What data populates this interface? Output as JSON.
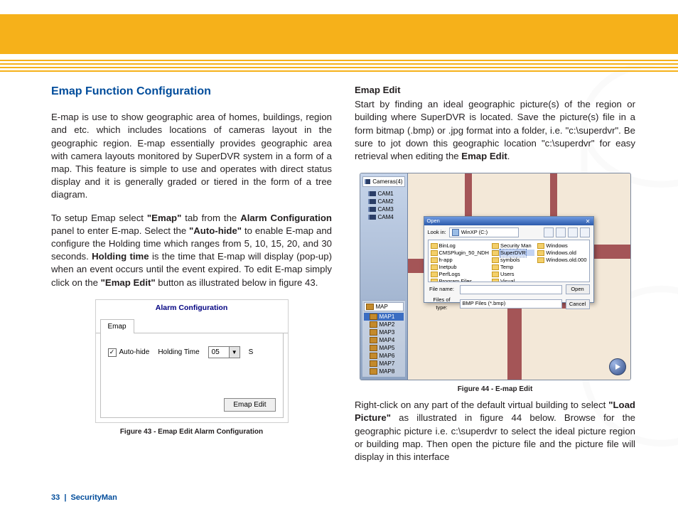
{
  "page": {
    "number": "33",
    "brand": "SecurityMan"
  },
  "left": {
    "title": "Emap Function Configuration",
    "p1": "E-map is use to show geographic area of homes, buildings, region and etc. which includes locations of cameras layout in the geographic region.   E-map essentially provides geographic area with camera layouts monitored by SuperDVR system in a form of a map.  This feature is simple to use and operates with direct status display and it is generally graded or tiered in the form of a tree diagram.",
    "p2_a": "To setup Emap select ",
    "p2_b": "\"Emap\"",
    "p2_c": " tab from the ",
    "p2_d": "Alarm Configuration",
    "p2_e": " panel to enter E-map.  Select the ",
    "p2_f": "\"Auto-hide\"",
    "p2_g": " to enable E-map and configure the Holding time which ranges from 5, 10, 15, 20, and 30 seconds.  ",
    "p2_h": "Holding time",
    "p2_i": " is the time that E-map will display (pop-up) when an event occurs until the event expired.  To edit E-map simply click on the ",
    "p2_j": "\"Emap Edit\"",
    "p2_k": " button as illustrated below in figure 43."
  },
  "fig43": {
    "windowTitle": "Alarm Configuration",
    "tab": "Emap",
    "autoHide": "Auto-hide",
    "holdingTime": "Holding Time",
    "holdValue": "05",
    "unit": "S",
    "editBtn": "Emap Edit",
    "caption": "Figure 43 - Emap Edit Alarm Configuration"
  },
  "right": {
    "subhead": "Emap Edit",
    "p1_a": "Start by finding an ideal geographic picture(s) of the region or building where SuperDVR is located.  Save the picture(s) file in a form bitmap (.bmp) or .jpg format into a folder, i.e. \"c:\\superdvr\".  Be sure to jot down this geographic location \"c:\\superdvr\" for easy retrieval when editing the ",
    "p1_b": "Emap Edit",
    "p1_c": ".",
    "p2_a": "Right-click on any part of the default virtual building to select ",
    "p2_b": "\"Load Picture\"",
    "p2_c": " as illustrated in figure 44 below.  Browse for the geographic picture i.e. c:\\superdvr to select the ideal picture region or building map.  Then open the picture file and the picture file will display in this interface"
  },
  "fig44": {
    "caption": "Figure 44 -  E-map Edit",
    "sidebar": {
      "root": "Cameras(4)",
      "cams": [
        "CAM1",
        "CAM2",
        "CAM3",
        "CAM4"
      ],
      "mapGroup": "MAP",
      "maps": [
        "MAP1",
        "MAP2",
        "MAP3",
        "MAP4",
        "MAP5",
        "MAP6",
        "MAP7",
        "MAP8"
      ]
    },
    "dialog": {
      "title": "Open",
      "lookInLabel": "Look in:",
      "lookInValue": "WinXP (C:)",
      "files": [
        "BinLog",
        "Security Man",
        "Windows",
        "CMSPlugin_50_NDH",
        "SuperDVR",
        "Windows.old",
        "h-app",
        "symbols",
        "Windows.old.000",
        "Inetpub",
        "Temp",
        "",
        "PerfLogs",
        "Users",
        "",
        "Program Files",
        "Visual",
        ""
      ],
      "selectedIdx": 4,
      "fileNameLabel": "File name:",
      "fileNameValue": "",
      "fileTypeLabel": "Files of type:",
      "fileTypeValue": "BMP Files (*.bmp)",
      "openBtn": "Open",
      "cancelBtn": "Cancel"
    }
  }
}
